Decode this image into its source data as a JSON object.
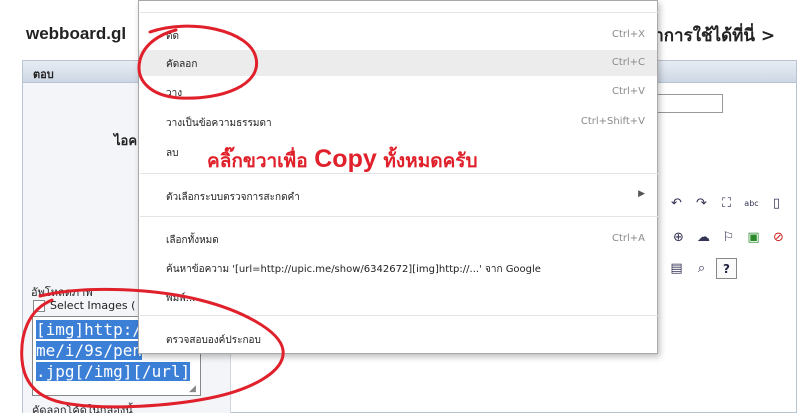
{
  "page": {
    "title": "webboard.gl",
    "title_right": "หาการใช้ได้ที่นี่ >",
    "panel_header": "ตอบ",
    "name_label": "ไอค"
  },
  "upload": {
    "label": "อัพโหลดภาพ",
    "select_images": "Select Images (",
    "code_lines": [
      "[img]http://u",
      "me/i/9s/pen",
      ".jpg[/img][/url]"
    ],
    "copy_hint": "คัดลอกโค้ดในกล่องนี้"
  },
  "toolbar": {
    "row1": [
      "↶",
      "↷",
      "⛶",
      "abc",
      "▯"
    ],
    "row2": [
      "⊕",
      "☁",
      "⚐",
      "▣",
      "⊘"
    ],
    "row3": [
      "▤",
      "⌕",
      "?"
    ]
  },
  "context_menu": {
    "items": [
      {
        "label": "ตัด",
        "shortcut": "Ctrl+X"
      },
      {
        "label": "คัดลอก",
        "shortcut": "Ctrl+C"
      },
      {
        "label": "วาง",
        "shortcut": "Ctrl+V"
      },
      {
        "label": "วางเป็นข้อความธรรมดา",
        "shortcut": "Ctrl+Shift+V"
      },
      {
        "label": "ลบ",
        "shortcut": ""
      },
      {
        "label": "ตัวเลือกระบบตรวจการสะกดคำ",
        "shortcut": ""
      },
      {
        "label": "เลือกทั้งหมด",
        "shortcut": "Ctrl+A"
      },
      {
        "label": "ค้นหาข้อความ '[url=http://upic.me/show/6342672][img]http://...' จาก Google",
        "shortcut": ""
      },
      {
        "label": "พิมพ์...",
        "shortcut": ""
      },
      {
        "label": "ตรวจสอบองค์ประกอบ",
        "shortcut": ""
      }
    ],
    "submenu_arrow": "▶"
  },
  "annotation": {
    "prefix": "คลิ๊กขวาเพื่อ",
    "copy_word": "Copy",
    "suffix": "ทั้งหมดครับ",
    "color": "#e0202a"
  },
  "colors": {
    "selection": "#3b7fd6",
    "menu_hover": "#ececec",
    "panel_border": "#b8c4d4"
  }
}
